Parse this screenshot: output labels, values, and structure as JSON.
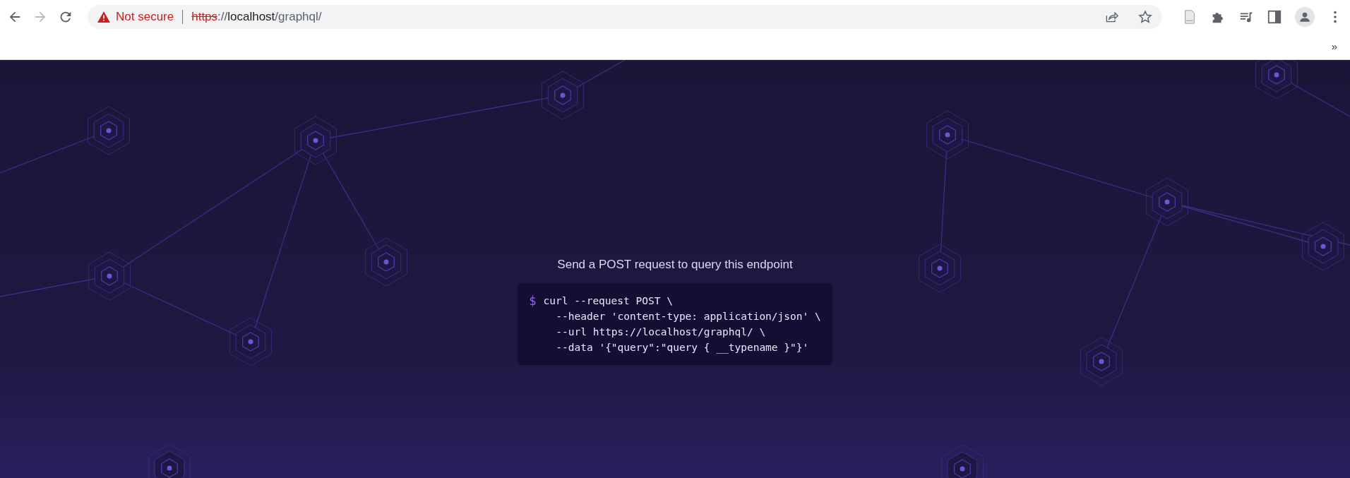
{
  "browser": {
    "security": "Not secure",
    "url": {
      "scheme": "https",
      "separator": "://",
      "host": "localhost",
      "path": "/graphql/"
    },
    "bookmarks_overflow": "»"
  },
  "page": {
    "heading": "Send a POST request to query this endpoint",
    "code": {
      "prompt": "$",
      "lines": [
        {
          "kind": "command",
          "text": "curl --request POST \\"
        },
        {
          "kind": "continuation",
          "text": "--header 'content-type: application/json' \\"
        },
        {
          "kind": "continuation",
          "text": "--url https://localhost/graphql/ \\"
        },
        {
          "kind": "continuation",
          "text": "--data '{\"query\":\"query { __typename }\"}'"
        }
      ]
    }
  }
}
